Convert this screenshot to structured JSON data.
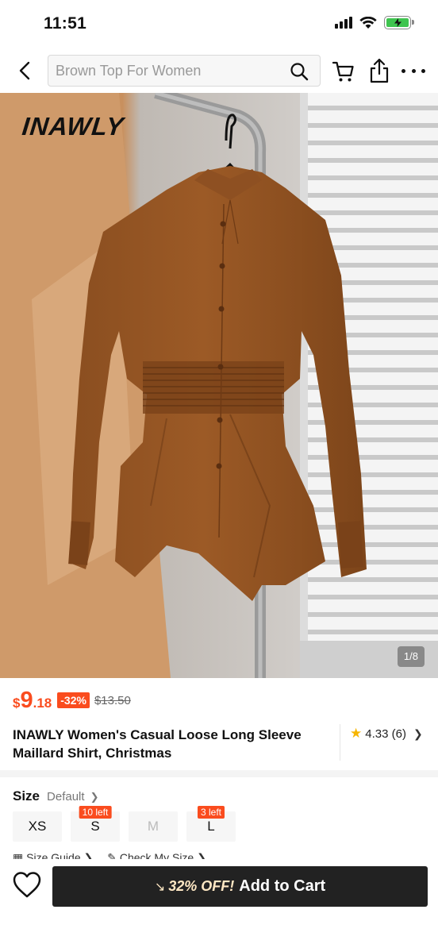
{
  "status_bar": {
    "time": "11:51"
  },
  "search": {
    "placeholder": "Brown Top For Women"
  },
  "icons": {
    "back": "chevron-left-icon",
    "search": "search-icon",
    "cart": "cart-icon",
    "share": "share-icon",
    "more": "more-icon",
    "wishlist": "heart-icon",
    "rating_star": "star-icon"
  },
  "gallery": {
    "brand": "INAWLY",
    "counter": "1/8"
  },
  "price": {
    "currency": "$",
    "integer": "9",
    "decimal": ".18",
    "discount": "-32%",
    "original": "$13.50"
  },
  "product": {
    "title": "INAWLY Women's Casual Loose Long Sleeve Maillard Shirt, Christmas",
    "rating": "4.33 (6)"
  },
  "size": {
    "label": "Size",
    "default": "Default",
    "options": [
      {
        "label": "XS",
        "tag": ""
      },
      {
        "label": "S",
        "tag": "10 left"
      },
      {
        "label": "M",
        "tag": ""
      },
      {
        "label": "L",
        "tag": "3 left"
      }
    ],
    "guide": "Size Guide",
    "check": "Check My Size"
  },
  "cta": {
    "promo": "32% OFF!",
    "label": "Add to Cart"
  },
  "colors": {
    "accent": "#fa4c1e",
    "cta_bg": "#222222",
    "rating_star": "#f7b500",
    "battery": "#3fc44f"
  }
}
